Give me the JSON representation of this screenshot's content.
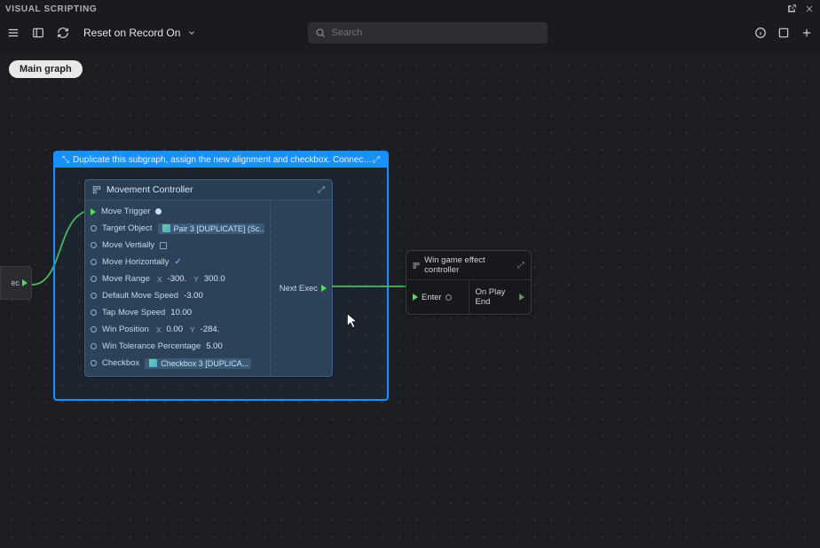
{
  "titlebar": {
    "title": "VISUAL SCRIPTING"
  },
  "toolbar": {
    "reset_label": "Reset on Record On",
    "search_placeholder": "Search"
  },
  "breadcrumb": {
    "main": "Main graph"
  },
  "blue_box": {
    "caption": "Duplicate this subgraph, assign the new alignment and checkbox. Connect in order and before the \"..."
  },
  "movement_node": {
    "title": "Movement Controller",
    "exec_in": "Move Trigger",
    "target_label": "Target Object",
    "target_chip": "Pair 3  [DUPLICATE] (Sc...",
    "move_vert": "Move Vertially",
    "move_horiz": "Move Horizontally",
    "range_label": "Move Range",
    "range_x": "-300.",
    "range_y": "300.0",
    "default_speed_label": "Default Move Speed",
    "default_speed": "-3.00",
    "tap_speed_label": "Tap Move Speed",
    "tap_speed": "10.00",
    "win_pos_label": "Win Position",
    "win_pos_x": "0.00",
    "win_pos_y": "-284.",
    "win_tol_label": "Win Tolerance Percentage",
    "win_tol": "5.00",
    "checkbox_label": "Checkbox",
    "checkbox_chip": "Checkbox 3 [DUPLICA...",
    "exec_out": "Next Exec"
  },
  "off_left": {
    "label": "ec"
  },
  "win_node": {
    "title": "Win game effect controller",
    "enter": "Enter",
    "on_play_end": "On Play End"
  }
}
